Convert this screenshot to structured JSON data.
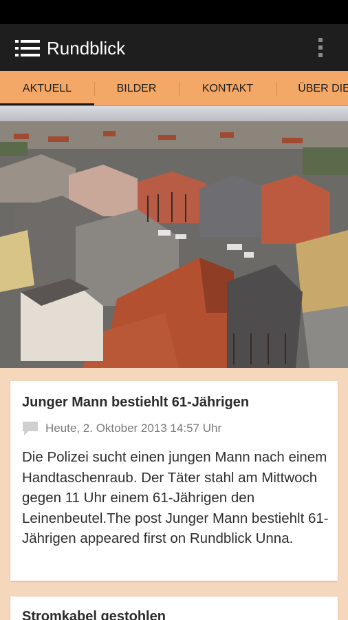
{
  "app": {
    "title": "Rundblick"
  },
  "tabs": [
    {
      "label": "AKTUELL",
      "active": true
    },
    {
      "label": "BILDER",
      "active": false
    },
    {
      "label": "KONTAKT",
      "active": false
    },
    {
      "label": "ÜBER DIE",
      "active": false
    }
  ],
  "posts": [
    {
      "title": "Junger Mann bestiehlt 61-Jährigen",
      "date": "Heute, 2. Oktober 2013 14:57 Uhr",
      "excerpt": "Die Polizei sucht einen jungen Mann nach einem Handtaschenraub. Der Täter stahl am Mittwoch gegen 11 Uhr einem 61-Jährigen den Leinenbeutel.The post Junger Mann bestiehlt 61-Jährigen appeared first on Rundblick Unna."
    },
    {
      "title": "Stromkabel gestohlen"
    }
  ],
  "colors": {
    "accent": "#f4a867",
    "background": "#f5d7bb",
    "app_bar": "#1e1e1e"
  },
  "icons": {
    "menu": "menu-icon",
    "overflow": "overflow-menu-icon",
    "comment": "comment-icon"
  }
}
